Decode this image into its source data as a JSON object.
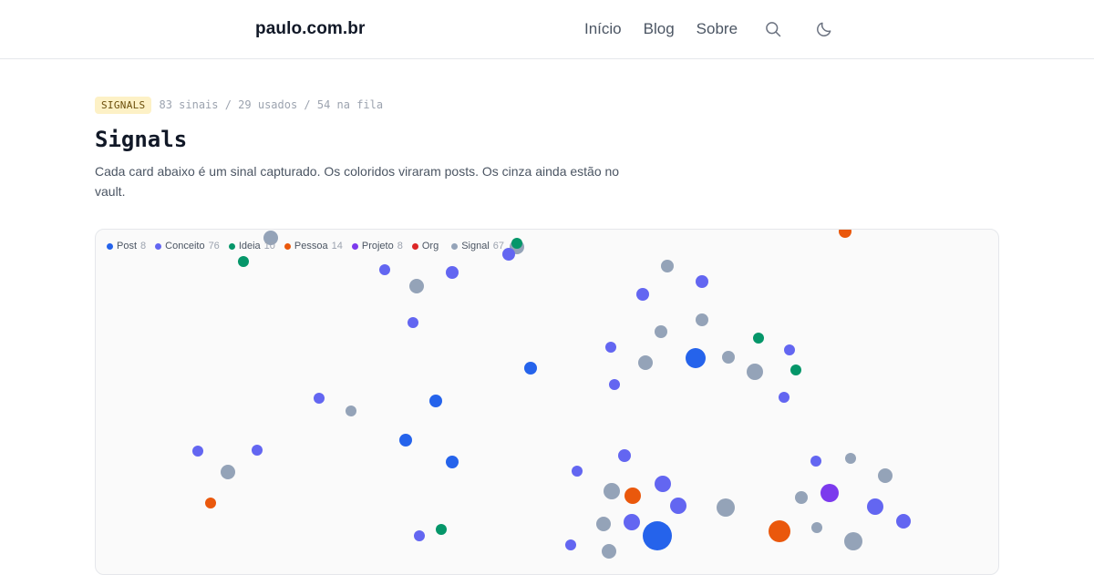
{
  "header": {
    "site_title": "paulo.com.br",
    "nav": [
      {
        "label": "Início"
      },
      {
        "label": "Blog"
      },
      {
        "label": "Sobre"
      }
    ],
    "icons": [
      "search-icon",
      "moon-icon"
    ]
  },
  "intro": {
    "badge": "SIGNALS",
    "meta": "83 sinais / 29 usados / 54 na fila",
    "title": "Signals",
    "description": "Cada card abaixo é um sinal capturado. Os coloridos viraram posts. Os cinza ainda estão no vault."
  },
  "legend": [
    {
      "label": "Post",
      "count": "8",
      "color": "#2563eb"
    },
    {
      "label": "Conceito",
      "count": "76",
      "color": "#6366f1"
    },
    {
      "label": "Ideia",
      "count": "10",
      "color": "#059669"
    },
    {
      "label": "Pessoa",
      "count": "14",
      "color": "#ea580c"
    },
    {
      "label": "Projeto",
      "count": "8",
      "color": "#7c3aed"
    },
    {
      "label": "Org",
      "count": "",
      "color": "#dc2626"
    },
    {
      "label": "Signal",
      "count": "67",
      "color": "#94a3b8"
    }
  ],
  "colors": {
    "post": "#2563eb",
    "conceito": "#6366f1",
    "ideia": "#059669",
    "pessoa": "#ea580c",
    "projeto": "#7c3aed",
    "org": "#dc2626",
    "signal": "#94a3b8"
  }
}
